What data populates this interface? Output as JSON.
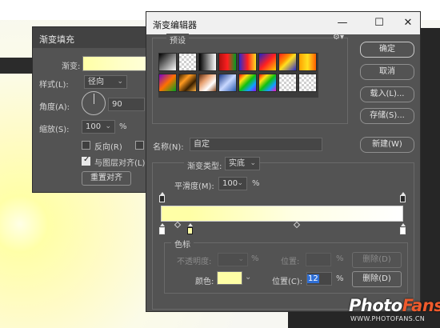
{
  "fill_dialog": {
    "title": "渐变填充",
    "gradient_label": "渐变:",
    "gradient_color": "#ffffa6",
    "style_label": "样式(L):",
    "style_value": "径向",
    "angle_label": "角度(A):",
    "angle_value": "90",
    "scale_label": "缩放(S):",
    "scale_value": "100",
    "scale_unit": "%",
    "reverse_label": "反向(R)",
    "align_label": "与图层对齐(L)",
    "reset_label": "重置对齐"
  },
  "editor": {
    "title": "渐变编辑器",
    "window_controls": {
      "minimize": "—",
      "maximize": "☐",
      "close": "✕"
    },
    "presets_label": "预设",
    "gear_icon": "gear-icon",
    "buttons": {
      "ok": "确定",
      "cancel": "取消",
      "load": "载入(L)...",
      "save": "存储(S)...",
      "new": "新建(W)"
    },
    "name_label": "名称(N):",
    "name_value": "自定",
    "type_label": "渐变类型:",
    "type_value": "实底",
    "smooth_label": "平滑度(M):",
    "smooth_value": "100",
    "smooth_unit": "%",
    "stops_section_label": "色标",
    "opacity_label": "不透明度:",
    "opacity_unit": "%",
    "opacity_position_label": "位置:",
    "opacity_position_unit": "%",
    "opacity_delete_label": "删除(D)",
    "color_label": "颜色:",
    "color_swatch": "#ffffa6",
    "color_position_label": "位置(C):",
    "color_position_value": "12",
    "color_position_unit": "%",
    "color_delete_label": "删除(D)"
  },
  "watermark": {
    "brand_a": "Photo",
    "brand_b": "Fans",
    "url": "WWW.PHOTOFANS.CN"
  }
}
